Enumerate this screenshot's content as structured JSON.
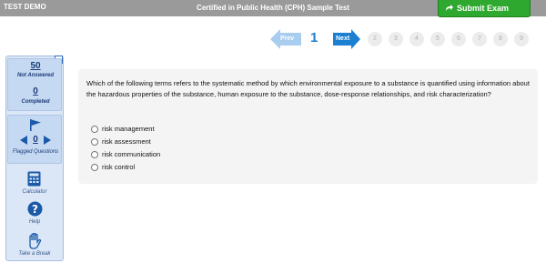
{
  "header": {
    "demo_label": "TEST DEMO",
    "title": "Certified in Public Health (CPH) Sample Test",
    "submit_label": "Submit Exam"
  },
  "pager": {
    "prev_label": "Prev",
    "next_label": "Next",
    "current": "1",
    "pages": [
      "2",
      "3",
      "4",
      "5",
      "6",
      "7",
      "8",
      "9"
    ]
  },
  "status": {
    "not_answered_count": "50",
    "not_answered_label": "Not Answered",
    "completed_count": "0",
    "completed_label": "Completed",
    "flagged_count": "0",
    "flagged_label": "Flagged Questions"
  },
  "tools": {
    "calculator_label": "Calculator",
    "help_label": "Help",
    "break_label": "Take a Break"
  },
  "question": {
    "text": "Which of the following terms refers to the systematic method by which environmental exposure to a substance is quantified using information about the hazardous properties of the substance, human exposure to the substance, dose-response relationships, and risk characterization?",
    "options": [
      "risk management",
      "risk assessment",
      "risk communication",
      "risk control"
    ]
  },
  "colors": {
    "accent": "#1b7fd2",
    "submit": "#2fa82f",
    "topbar": "#9a9a9a"
  }
}
